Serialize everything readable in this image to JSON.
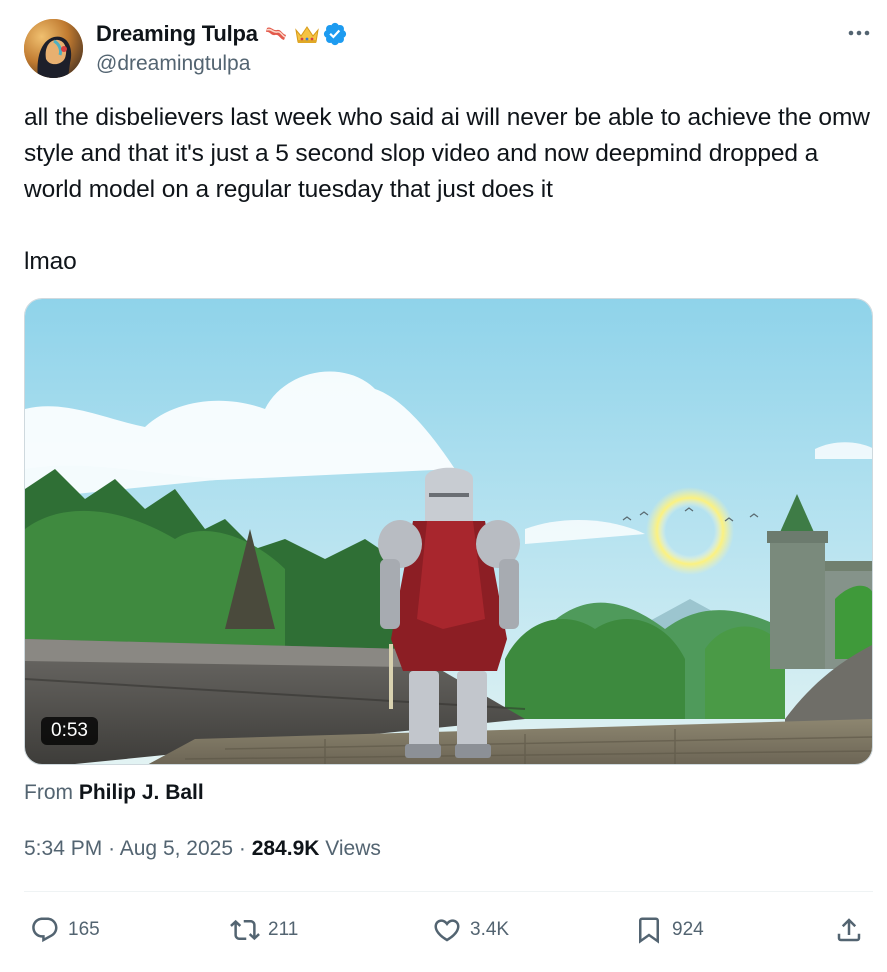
{
  "author": {
    "display_name": "Dreaming Tulpa",
    "handle": "@dreamingtulpa",
    "emoji": [
      "bacon-emoji",
      "crown-emoji"
    ],
    "verified": true,
    "verified_color": "#1d9bf0"
  },
  "tweet": {
    "text_lines": [
      "all the disbelievers last week who said ai will never be able to achieve the omw style and that it's just a 5 second slop video and now deepmind dropped a world model on a regular tuesday that just does it",
      "lmao"
    ]
  },
  "media": {
    "type": "video",
    "duration": "0:53"
  },
  "from": {
    "prefix": "From",
    "name": "Philip J. Ball"
  },
  "meta": {
    "time": "5:34 PM",
    "separator": "·",
    "date": "Aug 5, 2025",
    "views_count": "284.9K",
    "views_label": "Views"
  },
  "actions": {
    "reply_count": "165",
    "retweet_count": "211",
    "like_count": "3.4K",
    "bookmark_count": "924"
  },
  "colors": {
    "text": "#0f1419",
    "secondary": "#536471",
    "accent": "#1d9bf0"
  }
}
